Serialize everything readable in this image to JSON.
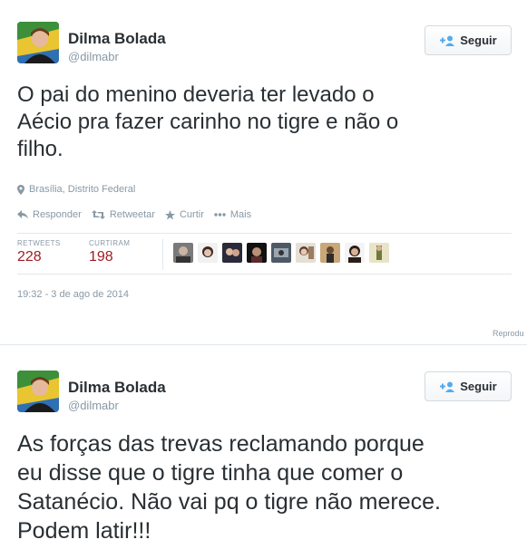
{
  "tweets": [
    {
      "user": {
        "name": "Dilma Bolada",
        "handle": "@dilmabr"
      },
      "follow_label": "Seguir",
      "text": "O pai do menino deveria ter levado o\nAécio pra fazer carinho no tigre e não o\nfilho.",
      "location": "Brasília, Distrito Federal",
      "actions": {
        "reply": "Responder",
        "retweet": "Retweetar",
        "favorite": "Curtir",
        "more": "Mais"
      },
      "stats": {
        "retweets_label": "RETWEETS",
        "retweets_value": "228",
        "likes_label": "CURTIRAM",
        "likes_value": "198"
      },
      "timestamp": "19:32 - 3 de ago de 2014"
    },
    {
      "user": {
        "name": "Dilma Bolada",
        "handle": "@dilmabr"
      },
      "follow_label": "Seguir",
      "text": "As forças das trevas reclamando porque\neu disse que o tigre tinha que comer o\nSatanécio. Não vai pq o tigre não merece.\nPodem latir!!!"
    }
  ],
  "credit": "Reprodu",
  "colors": {
    "stat_value": "#a11c24",
    "follow_icon": "#55acee",
    "muted": "#8899a6",
    "text": "#292f33",
    "border": "#e1e8ed"
  },
  "icons": [
    "add-user-icon",
    "location-pin-icon",
    "reply-icon",
    "retweet-icon",
    "star-icon",
    "more-icon"
  ]
}
